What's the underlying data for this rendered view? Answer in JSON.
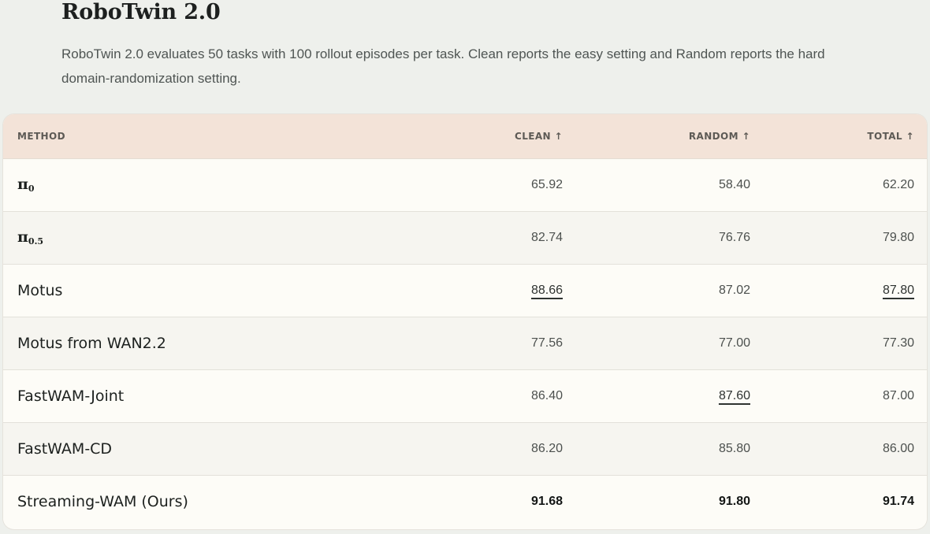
{
  "page": {
    "title": "RoboTwin 2.0",
    "description": "RoboTwin 2.0 evaluates 50 tasks with 100 rollout episodes per task. Clean reports the easy setting and Random reports the hard domain-randomization setting."
  },
  "table": {
    "headers": {
      "method": "METHOD",
      "clean": "CLEAN ↑",
      "random": "RANDOM ↑",
      "total": "TOTAL ↑"
    },
    "rows": [
      {
        "method": "π",
        "method_sub": "0",
        "clean": "65.92",
        "random": "58.40",
        "total": "62.20"
      },
      {
        "method": "π",
        "method_sub": "0.5",
        "clean": "82.74",
        "random": "76.76",
        "total": "79.80"
      },
      {
        "method": "Motus",
        "clean": "88.66",
        "random": "87.02",
        "total": "87.80"
      },
      {
        "method": "Motus from WAN2.2",
        "clean": "77.56",
        "random": "77.00",
        "total": "77.30"
      },
      {
        "method": "FastWAM-Joint",
        "clean": "86.40",
        "random": "87.60",
        "total": "87.00"
      },
      {
        "method": "FastWAM-CD",
        "clean": "86.20",
        "random": "85.80",
        "total": "86.00"
      },
      {
        "method": "Streaming-WAM (Ours)",
        "clean": "91.68",
        "random": "91.80",
        "total": "91.74"
      }
    ]
  }
}
